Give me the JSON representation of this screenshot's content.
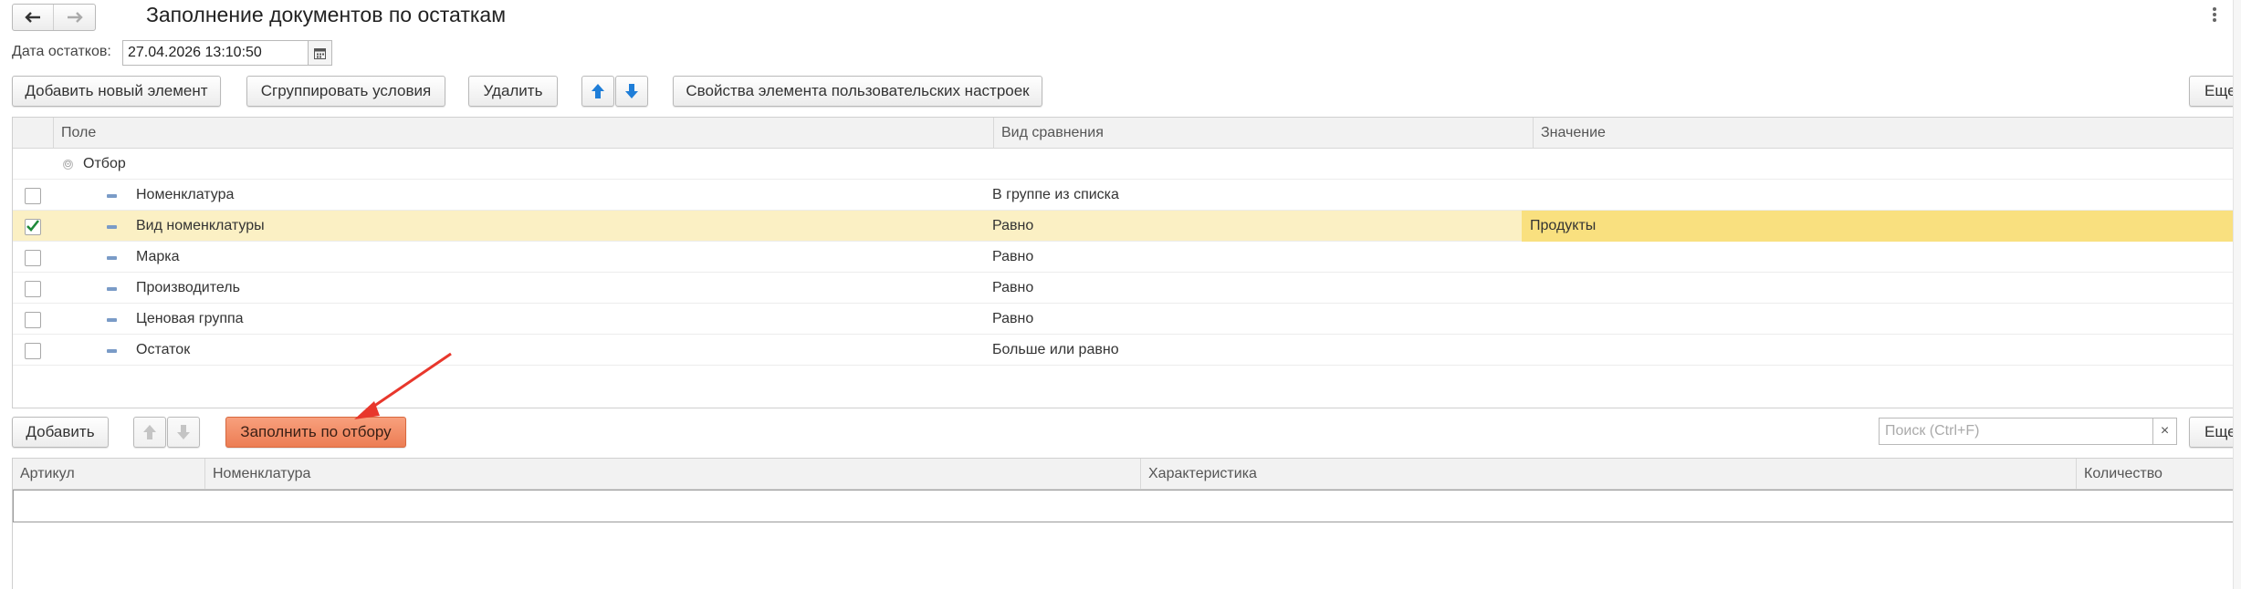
{
  "window": {
    "title": "Заполнение документов по остаткам",
    "back_icon": "arrow-left-icon",
    "forward_icon": "arrow-right-icon",
    "menu_icon": "kebab-menu-icon"
  },
  "date_field": {
    "label": "Дата остатков:",
    "value": "27.04.2026 13:10:50",
    "calendar_icon": "calendar-icon"
  },
  "toolbar": {
    "add_element": "Добавить новый элемент",
    "group_conditions": "Сгруппировать условия",
    "delete": "Удалить",
    "move_up_icon": "arrow-up-icon",
    "move_down_icon": "arrow-down-icon",
    "element_properties": "Свойства элемента пользовательских настроек",
    "more": "Еще"
  },
  "filter_table": {
    "columns": [
      "Поле",
      "Вид сравнения",
      "Значение"
    ],
    "group_label": "Отбор",
    "rows": [
      {
        "checked": false,
        "field": "Номенклатура",
        "comparison": "В группе из списка",
        "value": ""
      },
      {
        "checked": true,
        "field": "Вид номенклатуры",
        "comparison": "Равно",
        "value": "Продукты"
      },
      {
        "checked": false,
        "field": "Марка",
        "comparison": "Равно",
        "value": ""
      },
      {
        "checked": false,
        "field": "Производитель",
        "comparison": "Равно",
        "value": ""
      },
      {
        "checked": false,
        "field": "Ценовая группа",
        "comparison": "Равно",
        "value": ""
      },
      {
        "checked": false,
        "field": "Остаток",
        "comparison": "Больше или равно",
        "value": ""
      }
    ]
  },
  "toolbar2": {
    "add": "Добавить",
    "fill_by_filter": "Заполнить по отбору",
    "search_placeholder": "Поиск (Ctrl+F)",
    "clear": "×",
    "more": "Еще"
  },
  "items_table": {
    "columns": [
      "Артикул",
      "Номенклатура",
      "Характеристика",
      "Количество"
    ]
  },
  "colors": {
    "selected_row": "#fbf0c4",
    "selected_value": "#f9e07f",
    "accent_button": "#ec7d54",
    "annotation_arrow": "#e8372c"
  }
}
